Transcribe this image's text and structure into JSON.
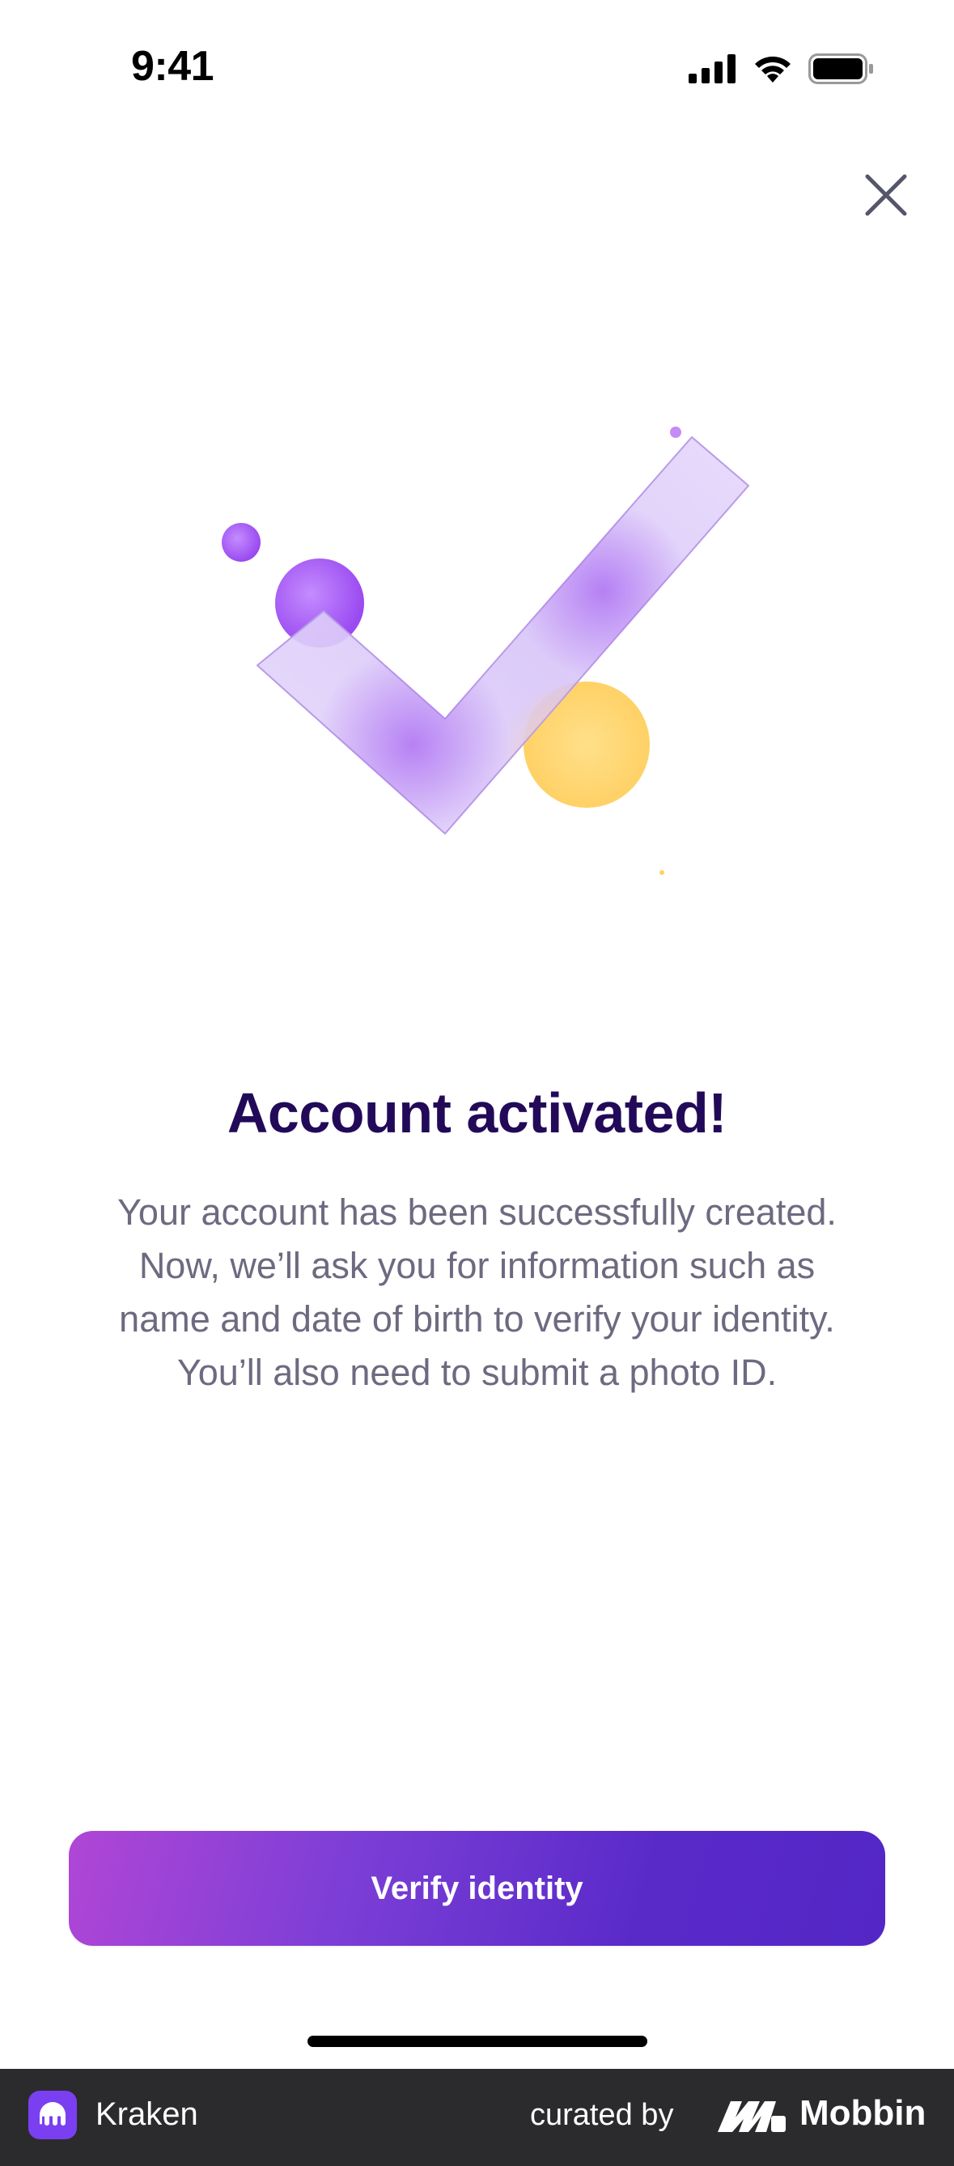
{
  "status_bar": {
    "time": "9:41"
  },
  "icons": {
    "close": "close-icon",
    "signal": "cellular-signal-icon",
    "wifi": "wifi-icon",
    "battery": "battery-icon",
    "hero": "checkmark-illustration"
  },
  "main": {
    "title": "Account activated!",
    "body_lines": [
      "Your account has been successfully created.",
      "Now, we’ll ask you for information such as",
      "name and date of birth to verify your identity.",
      "You’ll also need to submit a photo ID."
    ],
    "button_label": "Verify identity"
  },
  "footer": {
    "app_name": "Kraken",
    "curated_by": "curated by",
    "brand": "Mobbin"
  },
  "colors": {
    "title": "#220a59",
    "body_text": "#6d6a80",
    "button_start": "#b046d6",
    "button_end": "#5327c5",
    "accent_purple": "#a564f0",
    "accent_yellow": "#ffd36a",
    "footer_bg": "#2b2b2d"
  }
}
